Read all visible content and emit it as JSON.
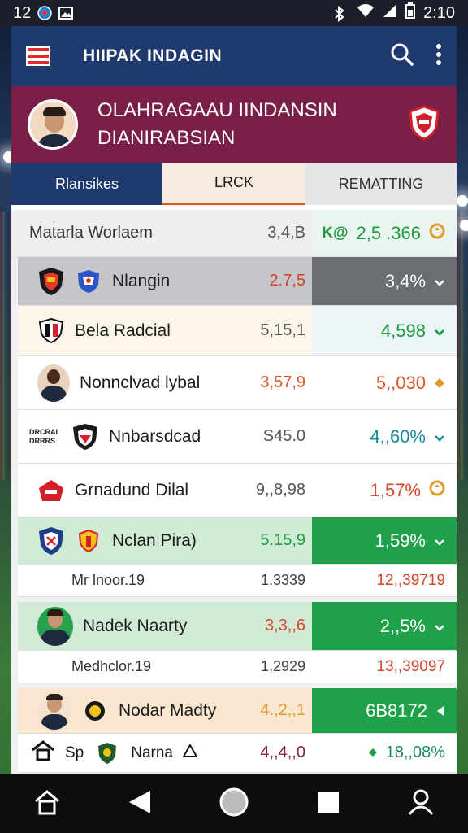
{
  "status_bar": {
    "time_left": "12",
    "time_right": "2:10",
    "icons": [
      "ball-icon",
      "image-icon",
      "bluetooth-icon",
      "wifi-icon",
      "signal-icon",
      "battery-icon"
    ]
  },
  "app_bar": {
    "title": "HIIPAK INDAGIN",
    "icons": [
      "flag-icon",
      "search-icon",
      "more-vert-icon"
    ]
  },
  "hero": {
    "line1": "OLAHRAGAAU IINDANSIN",
    "line2": "DIANIRABSIAN"
  },
  "tabs": [
    {
      "label": "Rlansikes"
    },
    {
      "label": "LRCK"
    },
    {
      "label": "REMATTING"
    }
  ],
  "summary": {
    "label": "Matarla Worlaem",
    "value": "3,4,B",
    "stat": "2,5 .366",
    "stat_prefix": "K@"
  },
  "rows": [
    {
      "name": "Nlangin",
      "value": "2.7,5",
      "stat": "3,4%",
      "trend": "down"
    },
    {
      "name": "Bela Radcial",
      "value": "5,15,1",
      "stat": "4,598",
      "trend": "down"
    },
    {
      "name": "Nonnclvad lybal",
      "value": "3,57,9",
      "stat": "5,,030",
      "trend": "down"
    },
    {
      "name": "Nnbarsdcad",
      "value": "S45.0",
      "stat": "4,,60%",
      "trend": "down",
      "logo_text": "DRCRAI\nDRRRS"
    },
    {
      "name": "Grnadund Dilal",
      "value": "9,,8,98",
      "stat": "1,57%",
      "trend": "up"
    },
    {
      "name": "Nclan Pira)",
      "value": "5.15,9",
      "stat": "1,59%",
      "trend": "down"
    },
    {
      "name": "Mr lnoor.19",
      "value": "1.3339",
      "stat": "12,,39719"
    },
    {
      "name": "Nadek Naarty",
      "value": "3,3,,6",
      "stat": "2,,5%",
      "trend": "down"
    },
    {
      "name": "Medhclor.19",
      "value": "1,2929",
      "stat": "13,,39097"
    },
    {
      "name": "Nodar Madty",
      "value": "4.,2,,1",
      "stat": "6B8172",
      "trend": "left"
    },
    {
      "name": "Sp",
      "name2": "Narna",
      "value": "4,,4,,0",
      "stat": "18,,08%"
    }
  ],
  "colors": {
    "appbar": "#1e3a6e",
    "hero": "#7a1f47",
    "gray_stat": "#6a6d72",
    "green_stat": "#1fa14a",
    "orange_text": "#e0562a",
    "green_text": "#1c9a3c",
    "teal_text": "#1a8a9a"
  },
  "nav": {
    "icons": [
      "home-icon",
      "back-icon",
      "home-circle-icon",
      "recents-icon",
      "profile-icon"
    ]
  }
}
